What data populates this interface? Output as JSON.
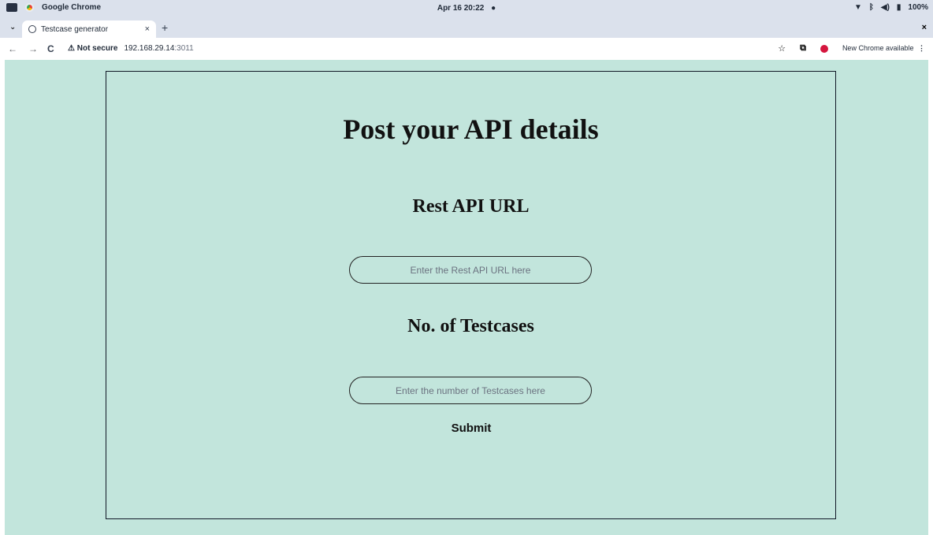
{
  "os": {
    "app_name": "Google Chrome",
    "clock": "Apr 16  20:22",
    "recording_dot": "●",
    "battery": "100%",
    "status_icons": [
      "wifi-icon",
      "bluetooth-icon",
      "volume-icon",
      "battery-icon"
    ]
  },
  "browser": {
    "tab_title": "Testcase generator",
    "tab_close": "×",
    "new_tab": "+",
    "strip_close": "×",
    "security_label": "⚠ Not secure",
    "url_host": "192.168.29.14",
    "url_port": ":3011",
    "profile_initial": "O",
    "update_label": "New Chrome available",
    "menu_dots": "⋮"
  },
  "page": {
    "title": "Post your API details",
    "url_label": "Rest API URL",
    "url_placeholder": "Enter the Rest API URL here",
    "count_label": "No. of Testcases",
    "count_placeholder": "Enter the number of Testcases here",
    "submit_label": "Submit"
  },
  "colors": {
    "page_background": "#c2e5dc",
    "browser_chrome": "#dbe1ec",
    "profile_accent": "#d5163e"
  }
}
